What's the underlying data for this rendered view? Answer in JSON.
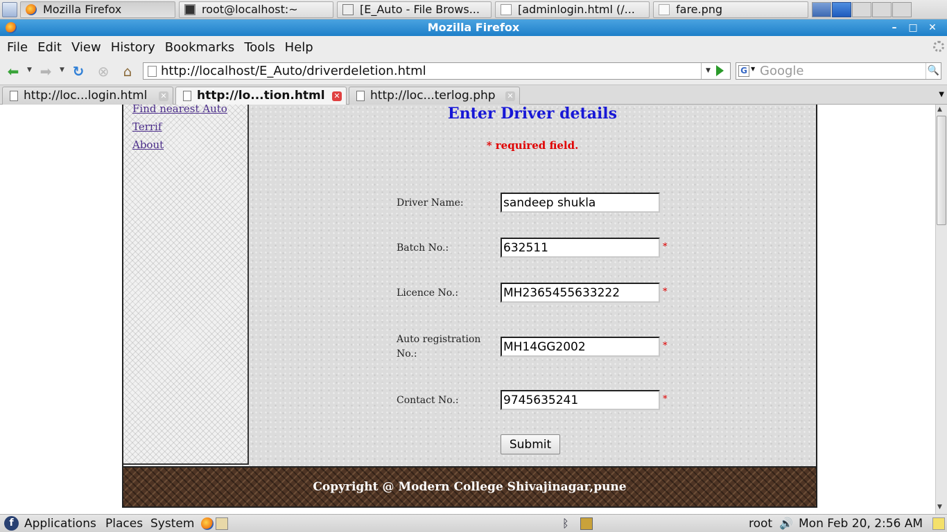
{
  "taskbar": {
    "windows": [
      {
        "label": "Mozilla Firefox"
      },
      {
        "label": "root@localhost:~"
      },
      {
        "label": "[E_Auto - File Brows..."
      },
      {
        "label": "[adminlogin.html (/..."
      },
      {
        "label": "fare.png"
      }
    ]
  },
  "window": {
    "title": "Mozilla Firefox"
  },
  "menubar": {
    "items": [
      "File",
      "Edit",
      "View",
      "History",
      "Bookmarks",
      "Tools",
      "Help"
    ]
  },
  "navbar": {
    "url": "http://localhost/E_Auto/driverdeletion.html",
    "search_placeholder": "Google"
  },
  "tabs": [
    {
      "label": "http://loc...login.html",
      "active": false
    },
    {
      "label": "http://lo...tion.html",
      "active": true
    },
    {
      "label": "http://loc...terlog.php",
      "active": false
    }
  ],
  "sidebar": {
    "links": [
      "Find nearest Auto",
      "Terrif",
      "About"
    ]
  },
  "form": {
    "heading": "Enter Driver details",
    "required_note": "* required field.",
    "required_marker": "*",
    "fields": [
      {
        "label": "Driver Name:",
        "value": "sandeep shukla",
        "required": false
      },
      {
        "label": "Batch No.:",
        "value": "632511",
        "required": true
      },
      {
        "label": "Licence No.:",
        "value": "MH2365455633222",
        "required": true
      },
      {
        "label": "Auto registration No.:",
        "value": "MH14GG2002",
        "required": true
      },
      {
        "label": "Contact No.:",
        "value": "9745635241",
        "required": true
      }
    ],
    "submit_label": "Submit"
  },
  "footer": {
    "copyright": "Copyright @ Modern College Shivajinagar,pune"
  },
  "panel": {
    "menus": [
      "Applications",
      "Places",
      "System"
    ],
    "user": "root",
    "clock": "Mon Feb 20,  2:56 AM"
  },
  "colors": {
    "heading": "#1717d6",
    "required": "#e00000",
    "title_bar": "#1e7fc9",
    "footer": "#4e3424"
  }
}
